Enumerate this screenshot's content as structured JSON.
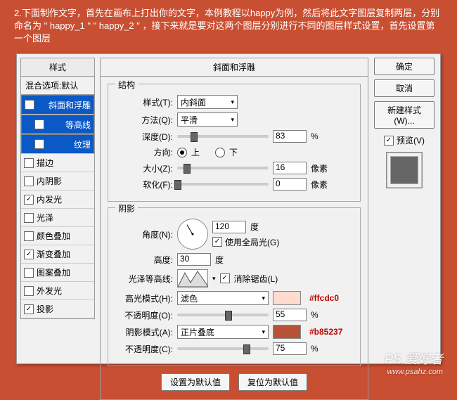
{
  "description": "2.下面制作文字，首先在画布上打出你的文字，本例教程以happy为例，然后将此文字图层复制两层，分别命名为 \" happy_1 \" \" happy_2 \" ，接下来就是要对这两个图层分别进行不同的图层样式设置，首先设置第一个图层",
  "left": {
    "hdr": "样式",
    "blend": "混合选项:默认",
    "items": [
      {
        "label": "斜面和浮雕",
        "checked": true,
        "sel": true
      },
      {
        "label": "等高线",
        "checked": true,
        "sub": true,
        "sel": true
      },
      {
        "label": "纹理",
        "checked": false,
        "sub": true,
        "sel": true
      },
      {
        "label": "描边",
        "checked": false
      },
      {
        "label": "内阴影",
        "checked": false
      },
      {
        "label": "内发光",
        "checked": true
      },
      {
        "label": "光泽",
        "checked": false
      },
      {
        "label": "颜色叠加",
        "checked": false
      },
      {
        "label": "渐变叠加",
        "checked": true
      },
      {
        "label": "图案叠加",
        "checked": false
      },
      {
        "label": "外发光",
        "checked": false
      },
      {
        "label": "投影",
        "checked": true
      }
    ]
  },
  "mid": {
    "title": "斜面和浮雕",
    "struct": {
      "legend": "结构",
      "styleLbl": "样式(T):",
      "styleVal": "内斜面",
      "methodLbl": "方法(Q):",
      "methodVal": "平滑",
      "depthLbl": "深度(D):",
      "depthVal": "83",
      "depthUnit": "%",
      "dirLbl": "方向:",
      "up": "上",
      "down": "下",
      "sizeLbl": "大小(Z):",
      "sizeVal": "16",
      "sizeUnit": "像素",
      "softLbl": "软化(F):",
      "softVal": "0",
      "softUnit": "像素"
    },
    "shade": {
      "legend": "阴影",
      "angleLbl": "角度(N):",
      "angleVal": "120",
      "angleUnit": "度",
      "globalLbl": "使用全局光(G)",
      "altLbl": "高度:",
      "altVal": "30",
      "altUnit": "度",
      "glossLbl": "光泽等高线:",
      "antiLbl": "消除锯齿(L)",
      "hlModeLbl": "高光模式(H):",
      "hlModeVal": "滤色",
      "hlHex": "#ffcdc0",
      "hlOpLbl": "不透明度(O):",
      "hlOpVal": "55",
      "hlOpUnit": "%",
      "shModeLbl": "阴影模式(A):",
      "shModeVal": "正片叠底",
      "shHex": "#b85237",
      "shOpLbl": "不透明度(C):",
      "shOpVal": "75",
      "shOpUnit": "%"
    },
    "defBtn": "设置为默认值",
    "resetBtn": "复位为默认值"
  },
  "right": {
    "ok": "确定",
    "cancel": "取消",
    "newStyle": "新建样式(W)...",
    "previewLbl": "预览(V)"
  },
  "watermark": {
    "main": "PS 爱好者",
    "sub": "www.psahz.com"
  }
}
